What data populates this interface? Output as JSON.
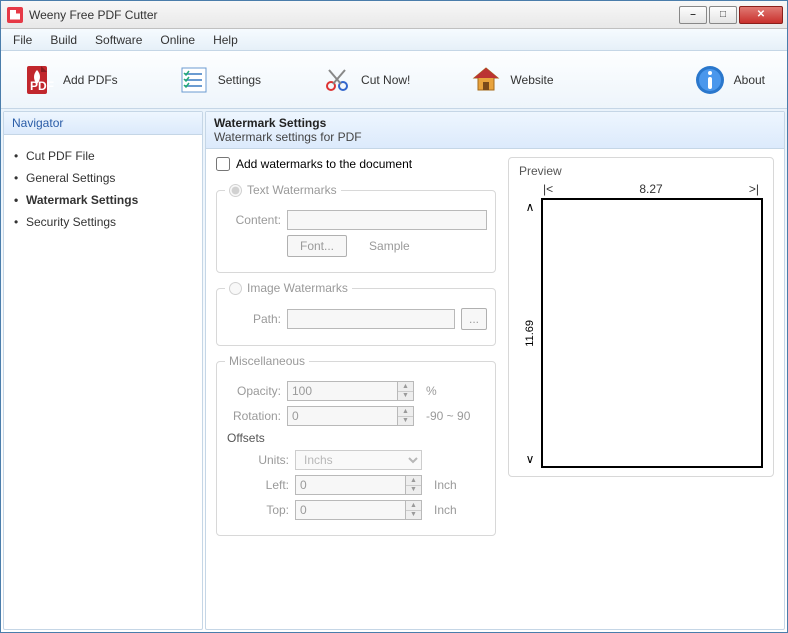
{
  "window": {
    "title": "Weeny Free PDF Cutter"
  },
  "menu": [
    "File",
    "Build",
    "Software",
    "Online",
    "Help"
  ],
  "toolbar": {
    "addpdfs": "Add PDFs",
    "settings": "Settings",
    "cutnow": "Cut Now!",
    "website": "Website",
    "about": "About"
  },
  "sidebar": {
    "title": "Navigator",
    "items": [
      "Cut PDF File",
      "General Settings",
      "Watermark Settings",
      "Security Settings"
    ],
    "active_index": 2
  },
  "panel": {
    "title": "Watermark Settings",
    "subtitle": "Watermark settings for PDF",
    "add_check_label": "Add watermarks to the document",
    "add_checked": false,
    "text_wm": {
      "legend": "Text Watermarks",
      "content_label": "Content:",
      "content_value": "",
      "font_btn": "Font...",
      "sample_label": "Sample"
    },
    "image_wm": {
      "legend": "Image Watermarks",
      "path_label": "Path:",
      "path_value": "",
      "browse_label": "..."
    },
    "misc": {
      "legend": "Miscellaneous",
      "opacity_label": "Opacity:",
      "opacity_value": "100",
      "opacity_unit": "%",
      "rotation_label": "Rotation:",
      "rotation_value": "0",
      "rotation_range": "-90 ~ 90",
      "offsets_label": "Offsets",
      "units_label": "Units:",
      "units_value": "Inchs",
      "left_label": "Left:",
      "left_value": "0",
      "left_unit": "Inch",
      "top_label": "Top:",
      "top_value": "0",
      "top_unit": "Inch"
    },
    "preview": {
      "title": "Preview",
      "width": "8.27",
      "height": "11.69",
      "lt": "|<",
      "gt": ">|",
      "up": "∧",
      "dn": "∨"
    }
  }
}
